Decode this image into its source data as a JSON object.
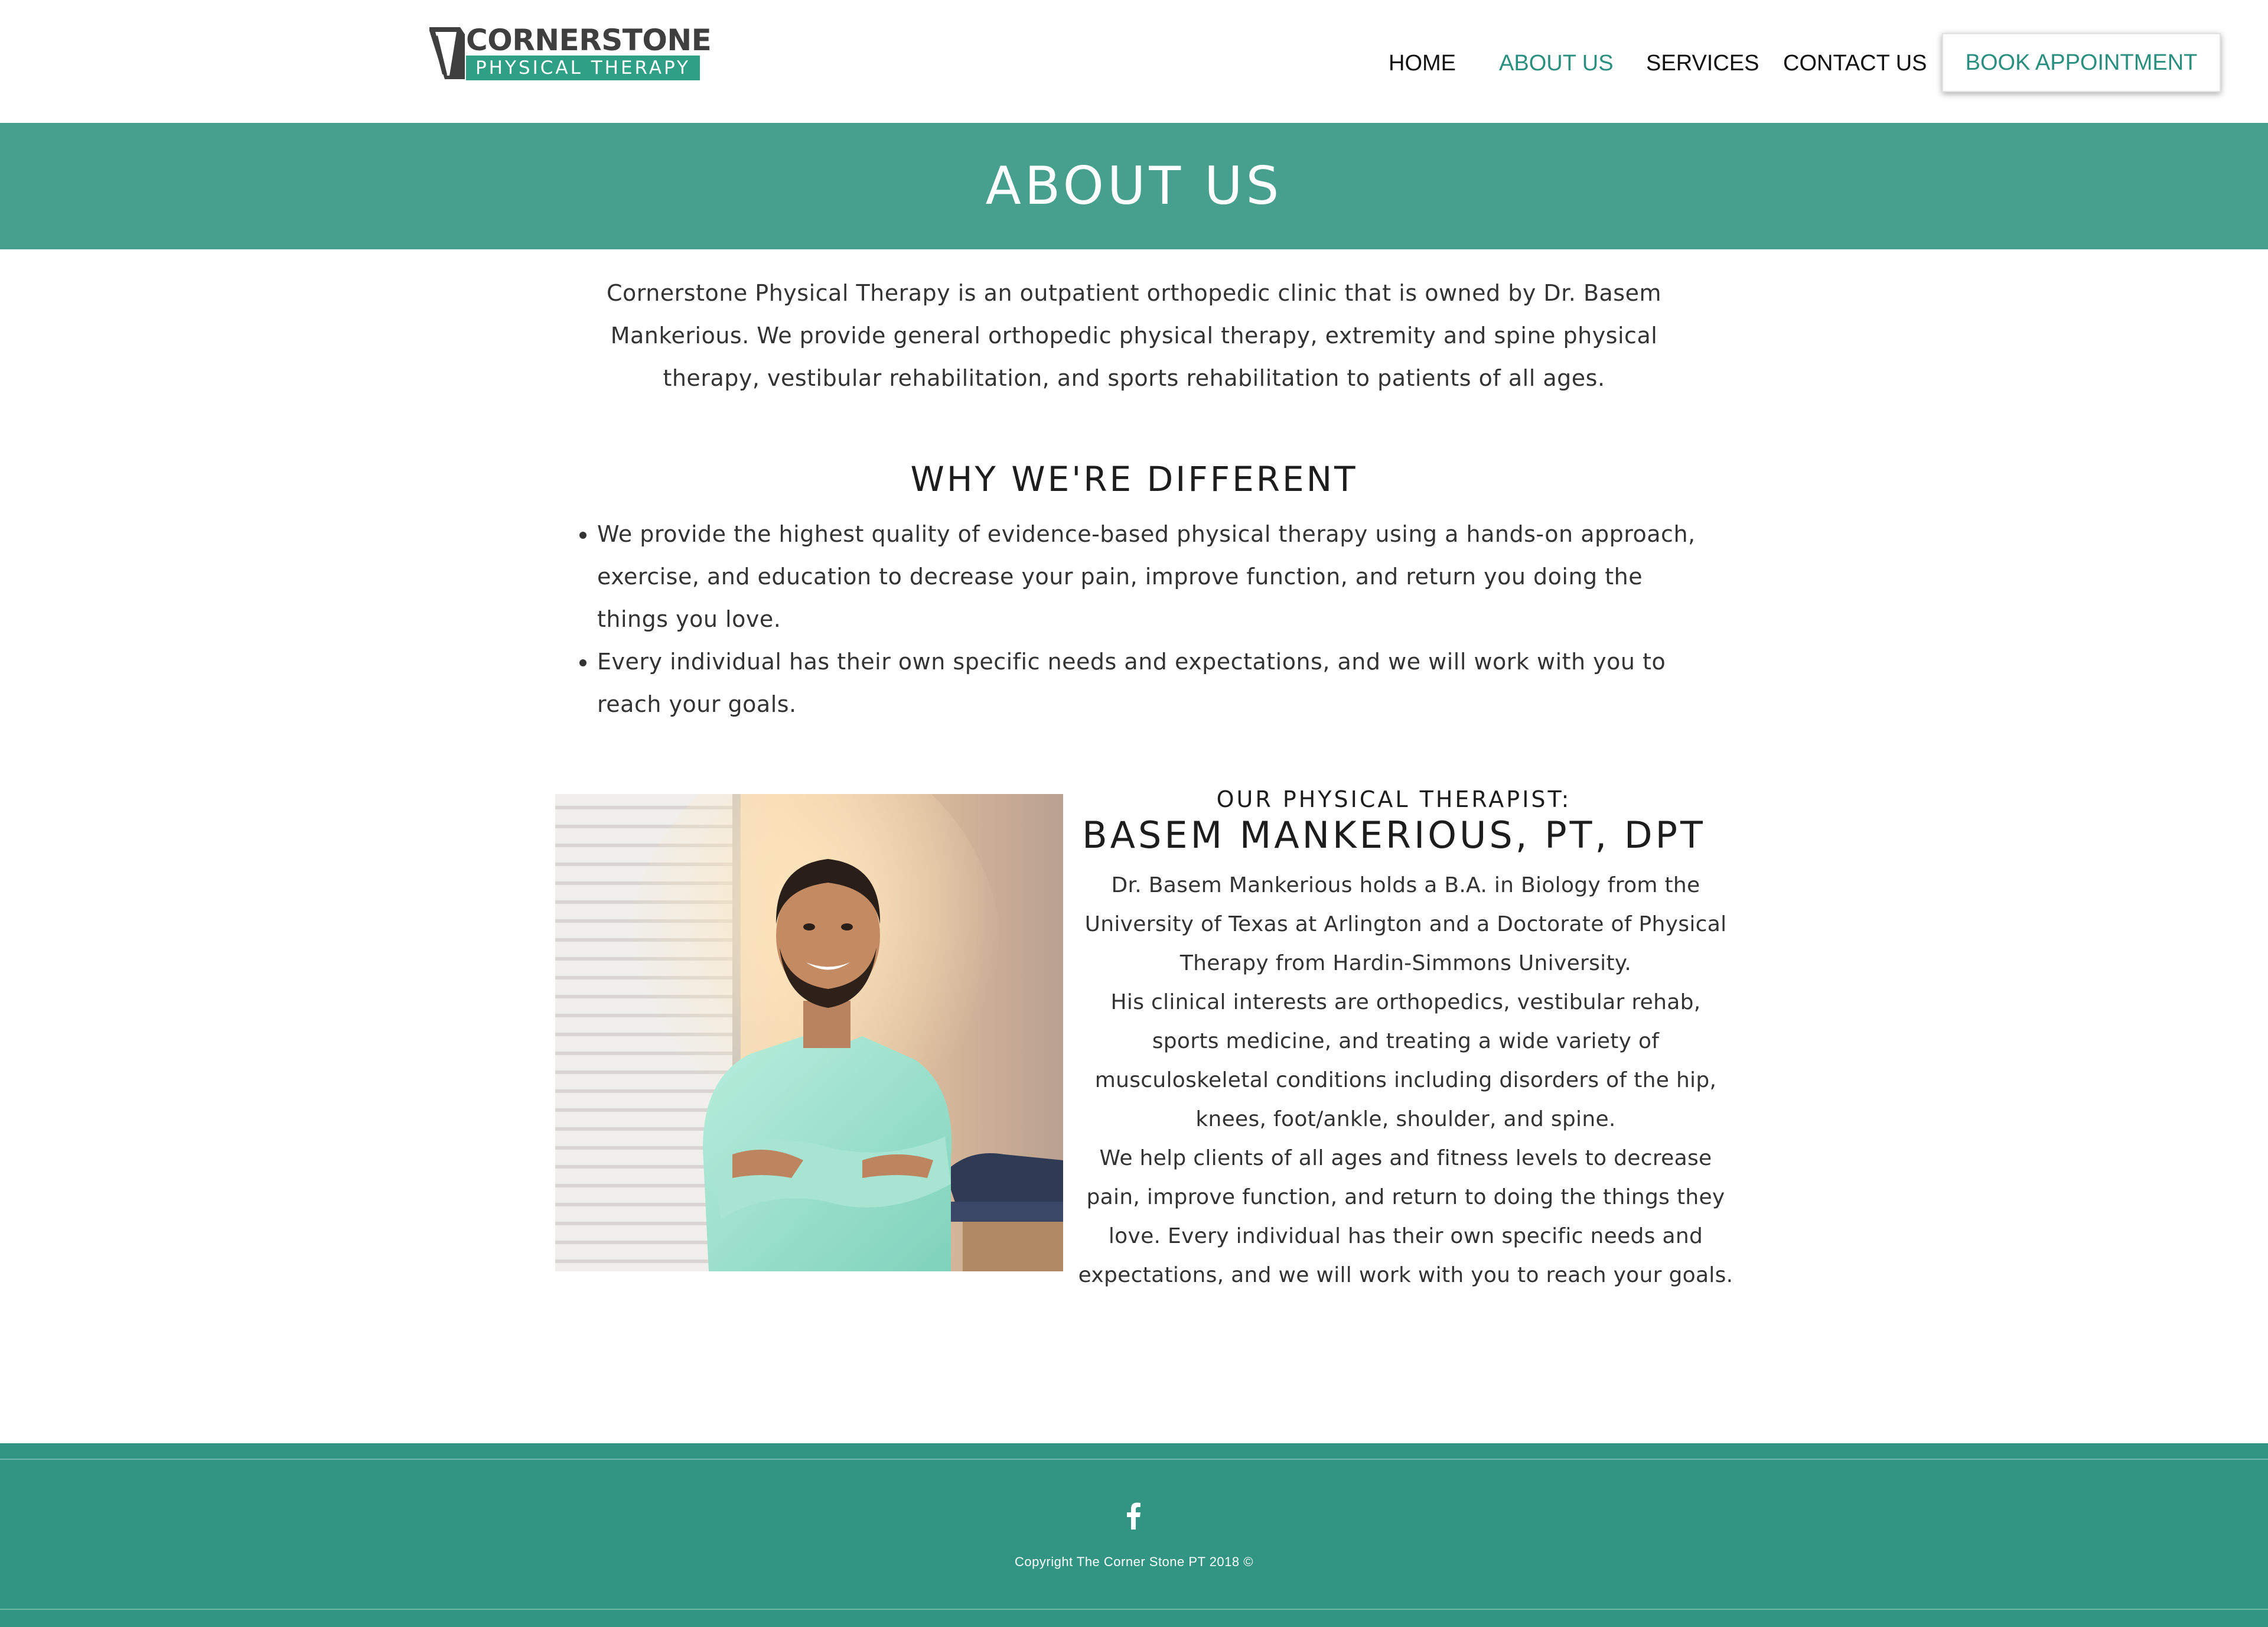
{
  "header": {
    "logo": {
      "word": "CORNERSTONE",
      "tagline": "PHYSICAL THERAPY"
    },
    "nav": [
      {
        "label": "HOME",
        "active": false
      },
      {
        "label": "ABOUT US",
        "active": true
      },
      {
        "label": "SERVICES",
        "active": false
      },
      {
        "label": "CONTACT US",
        "active": false
      }
    ],
    "book_button": "BOOK APPOINTMENT"
  },
  "hero": {
    "title": "ABOUT US"
  },
  "intro": {
    "text": "Cornerstone Physical Therapy is an outpatient orthopedic clinic that is owned by Dr. Basem Mankerious. We provide general orthopedic physical therapy, extremity and spine physical therapy, vestibular rehabilitation, and sports rehabilitation to patients of all ages."
  },
  "why": {
    "heading": "WHY WE'RE DIFFERENT",
    "items": [
      "We provide the highest quality of evidence-based physical therapy using a hands-on approach, exercise, and education to decrease your pain, improve function, and return you doing the things you love.",
      "Every individual has their own specific needs and expectations, and we will work with you to reach your goals."
    ]
  },
  "therapist": {
    "eyebrow": "OUR PHYSICAL THERAPIST:",
    "name": "BASEM MANKERIOUS, PT, DPT",
    "bio": [
      "Dr. Basem Mankerious holds a B.A. in Biology from the University of Texas at Arlington and a Doctorate of Physical Therapy from Hardin-Simmons University.",
      "His clinical interests are orthopedics, vestibular rehab, sports medicine, and treating a wide variety of musculoskeletal conditions including disorders of the hip, knees, foot/ankle, shoulder, and spine.",
      "We help clients of all ages and fitness levels to decrease pain, improve function, and return to doing the things they love. Every individual has their own specific needs and expectations, and we will work with you to reach your goals."
    ]
  },
  "footer": {
    "social_icon": "facebook-icon",
    "copyright": "Copyright The Corner Stone PT 2018 ©"
  },
  "colors": {
    "brand_teal": "#479f8d",
    "footer_teal": "#329482",
    "accent_text": "#2a8f7f"
  }
}
